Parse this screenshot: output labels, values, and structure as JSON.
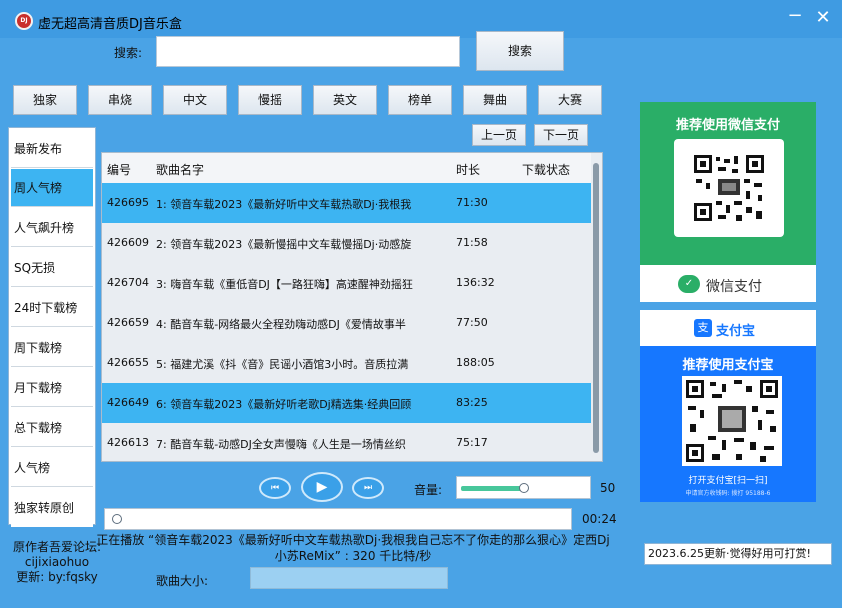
{
  "window": {
    "app_icon_text": "DJ",
    "title": "虚无超高清音质DJ音乐盒",
    "minimize_glyph": "−",
    "close_glyph": "✕"
  },
  "search": {
    "label": "搜索:",
    "value": "",
    "button_label": "搜索"
  },
  "categories": [
    "独家",
    "串烧",
    "中文",
    "慢摇",
    "英文",
    "榜单",
    "舞曲",
    "大赛"
  ],
  "paging": {
    "prev_label": "上一页",
    "next_label": "下一页"
  },
  "sidebar": {
    "items": [
      "最新发布",
      "周人气榜",
      "人气飙升榜",
      "SQ无损",
      "24时下载榜",
      "周下载榜",
      "月下载榜",
      "总下载榜",
      "人气榜",
      "独家转原创"
    ],
    "active_index": 1
  },
  "song_list": {
    "headers": {
      "id": "编号",
      "name": "歌曲名字",
      "duration": "时长",
      "status": "下载状态"
    },
    "rows": [
      {
        "id": "426695",
        "name": "1: 领音车载2023《最新好听中文车载热歌Dj·我根我",
        "duration": "71:30",
        "selected": true
      },
      {
        "id": "426609",
        "name": "2: 领音车载2023《最新慢摇中文车载慢摇Dj·动感旋",
        "duration": "71:58",
        "selected": false
      },
      {
        "id": "426704",
        "name": "3: 嗨音车载《重低音DJ【一路狂嗨】高速醒神劲摇狂",
        "duration": "136:32",
        "selected": false
      },
      {
        "id": "426659",
        "name": "4: 酷音车载-网络最火全程劲嗨动感DJ《爱情故事半",
        "duration": "77:50",
        "selected": false
      },
      {
        "id": "426655",
        "name": "5: 福建尤溪《抖《音》民谣小酒馆3小时。音质拉满",
        "duration": "188:05",
        "selected": false
      },
      {
        "id": "426649",
        "name": "6: 领音车载2023《最新好听老歌Dj精选集·经典回顾",
        "duration": "83:25",
        "selected": true
      },
      {
        "id": "426613",
        "name": "7: 酷音车载-动感DJ全女声慢嗨《人生是一场情丝织",
        "duration": "75:17",
        "selected": false
      }
    ]
  },
  "player": {
    "prev_icon": "⏮",
    "play_icon": "▶",
    "next_icon": "⏭",
    "volume_label": "音量:",
    "volume_value": "50",
    "volume_fraction": 0.5,
    "progress_fraction": 0.0,
    "progress_time": "00:24"
  },
  "status": {
    "now_playing": "正在播放 “领音车载2023《最新好听中文车载热歌Dj·我根我自己忘不了你走的那么狠心》定西Dj小苏ReMix” : 320 千比特/秒",
    "author_line1": "原作者吾爱论坛:",
    "author_line2": "cijixiaohuo",
    "author_line3": "更新: by:fqsky",
    "size_label": "歌曲大小:",
    "update_note": "2023.6.25更新·觉得好用可打赏!"
  },
  "payments": {
    "wechat": {
      "title": "推荐使用微信支付",
      "logo_glyph": "✓",
      "name": "微信支付",
      "color": "#2aae67"
    },
    "alipay": {
      "logo_glyph": "支",
      "name": "支付宝",
      "title": "推荐使用支付宝",
      "open_text": "打开支付宝[扫一扫]",
      "contact_text": "申请官方收钱码: 拨打 95188-6",
      "color": "#1677ff"
    }
  },
  "colors": {
    "background": "#4aa3e6",
    "selected_row": "#3db4f2",
    "volume_fill": "#48c79b"
  }
}
